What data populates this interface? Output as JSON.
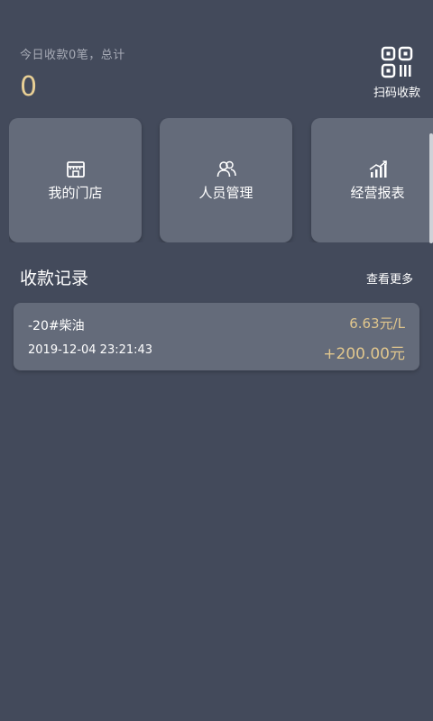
{
  "summary": {
    "label": "今日收款0笔，总计",
    "amount": "0"
  },
  "scan": {
    "icon": "qr-code-icon",
    "label": "扫码收款"
  },
  "cards": [
    {
      "icon": "store-icon",
      "label": "我的门店"
    },
    {
      "icon": "people-icon",
      "label": "人员管理"
    },
    {
      "icon": "report-chart-icon",
      "label": "经营报表"
    }
  ],
  "records_section": {
    "title": "收款记录",
    "more_label": "查看更多"
  },
  "records": [
    {
      "name": "-20#柴油",
      "price": "6.63元/L",
      "time": "2019-12-04 23:21:43",
      "amount": "+200.00元"
    }
  ],
  "colors": {
    "background": "#434a5b",
    "card": "#646b7a",
    "accent_gold": "#e0c68d"
  }
}
